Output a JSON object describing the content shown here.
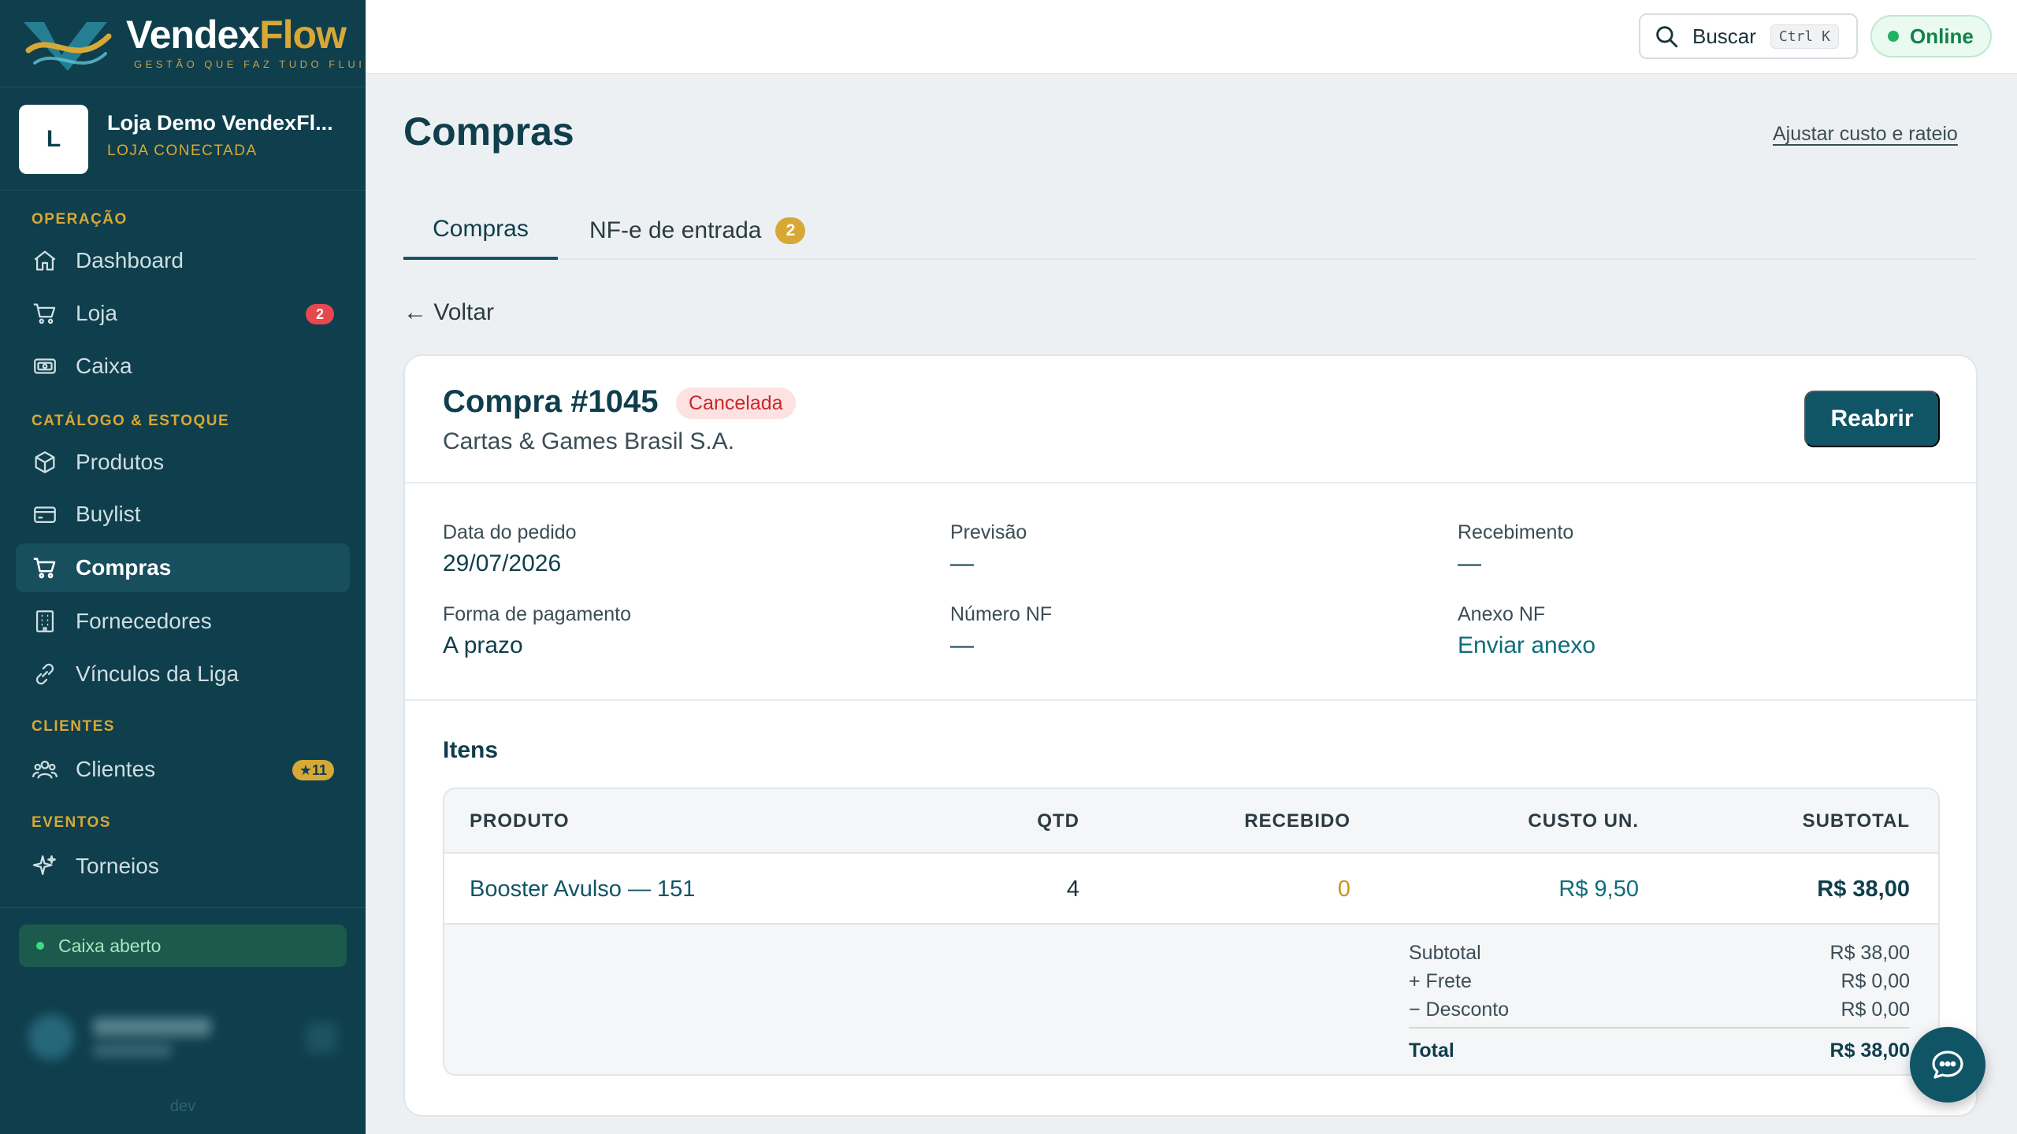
{
  "brand": {
    "name_part1": "Vendex",
    "name_part2": "Flow",
    "tagline": "GESTÃO QUE FAZ TUDO FLUIR"
  },
  "store": {
    "initial": "L",
    "name": "Loja Demo VendexFl...",
    "status": "LOJA CONECTADA"
  },
  "sidebar": {
    "sections": [
      {
        "label": "OPERAÇÃO"
      },
      {
        "label": "CATÁLOGO & ESTOQUE"
      },
      {
        "label": "CLIENTES"
      },
      {
        "label": "EVENTOS"
      }
    ],
    "items": [
      {
        "label": "Dashboard",
        "icon": "home-icon"
      },
      {
        "label": "Loja",
        "icon": "cart-icon",
        "badge": "2"
      },
      {
        "label": "Caixa",
        "icon": "cash-register-icon"
      },
      {
        "label": "Produtos",
        "icon": "box-icon"
      },
      {
        "label": "Buylist",
        "icon": "card-icon"
      },
      {
        "label": "Compras",
        "icon": "cart-icon",
        "active": true
      },
      {
        "label": "Fornecedores",
        "icon": "building-icon"
      },
      {
        "label": "Vínculos da Liga",
        "icon": "link-icon"
      },
      {
        "label": "Clientes",
        "icon": "users-icon",
        "badge": "★11"
      },
      {
        "label": "Torneios",
        "icon": "sparkle-icon"
      }
    ],
    "cash_status": "Caixa aberto",
    "env": "dev"
  },
  "topbar": {
    "search_label": "Buscar",
    "search_shortcut": "Ctrl K",
    "online_label": "Online"
  },
  "page": {
    "title": "Compras",
    "adjust_link": "Ajustar custo e rateio",
    "tabs": [
      {
        "label": "Compras",
        "active": true
      },
      {
        "label": "NF-e de entrada",
        "count": "2"
      }
    ],
    "back_label": "← Voltar"
  },
  "purchase": {
    "title": "Compra #1045",
    "status": "Cancelada",
    "supplier": "Cartas & Games Brasil S.A.",
    "reopen_label": "Reabrir",
    "fields": [
      {
        "label": "Data do pedido",
        "value": "29/07/2026"
      },
      {
        "label": "Previsão",
        "value": "—"
      },
      {
        "label": "Recebimento",
        "value": "—"
      },
      {
        "label": "Forma de pagamento",
        "value": "A prazo"
      },
      {
        "label": "Número NF",
        "value": "—"
      },
      {
        "label": "Anexo NF",
        "value": "Enviar anexo"
      }
    ],
    "items_title": "Itens",
    "columns": {
      "product": "PRODUTO",
      "qty": "QTD",
      "received": "RECEBIDO",
      "unit_cost": "CUSTO UN.",
      "subtotal": "SUBTOTAL"
    },
    "items": [
      {
        "product": "Booster Avulso — 151",
        "qty": "4",
        "received": "0",
        "unit_cost": "R$ 9,50",
        "subtotal": "R$ 38,00"
      }
    ],
    "summary": {
      "subtotal_label": "Subtotal",
      "subtotal_value": "R$ 38,00",
      "freight_label": "+ Frete",
      "freight_value": "R$ 0,00",
      "discount_label": "− Desconto",
      "discount_value": "R$ 0,00",
      "total_label": "Total",
      "total_value": "R$ 38,00"
    }
  },
  "colors": {
    "sidebar_bg": "#0f3e4c",
    "accent_gold": "#d8a836",
    "primary": "#0f5566",
    "danger": "#c8282e",
    "success": "#12814a"
  }
}
